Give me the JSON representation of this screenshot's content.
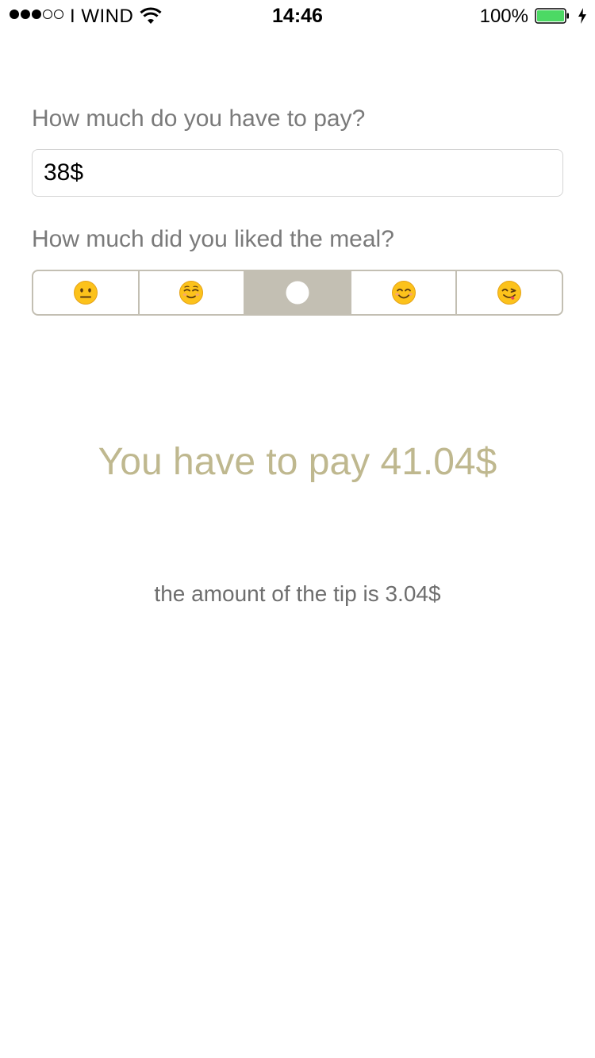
{
  "status_bar": {
    "signal": [
      "filled",
      "filled",
      "filled",
      "empty",
      "empty"
    ],
    "carrier": "I WIND",
    "wifi_icon": "wifi-icon",
    "time": "14:46",
    "battery_percent": "100%",
    "battery_level": 1.0,
    "battery_color": "#4cd964",
    "charging_icon": "bolt-icon"
  },
  "form": {
    "amount_question": "How much do you have to pay?",
    "amount_value": "38$",
    "rating_question": "How much did you liked the meal?",
    "rating_options": [
      {
        "icon": "neutral-face-icon"
      },
      {
        "icon": "relieved-face-icon"
      },
      {
        "icon": "selected-indicator-icon",
        "selected": true
      },
      {
        "icon": "smiling-face-icon"
      },
      {
        "icon": "yummy-face-icon"
      }
    ],
    "selected_index": 2
  },
  "result": {
    "total_text": "You have to pay 41.04$",
    "tip_text": "the amount of the tip is 3.04$"
  },
  "colors": {
    "accent": "#bfb88f",
    "segment": "#c3bfb3",
    "question_text": "#7a7a7a"
  }
}
